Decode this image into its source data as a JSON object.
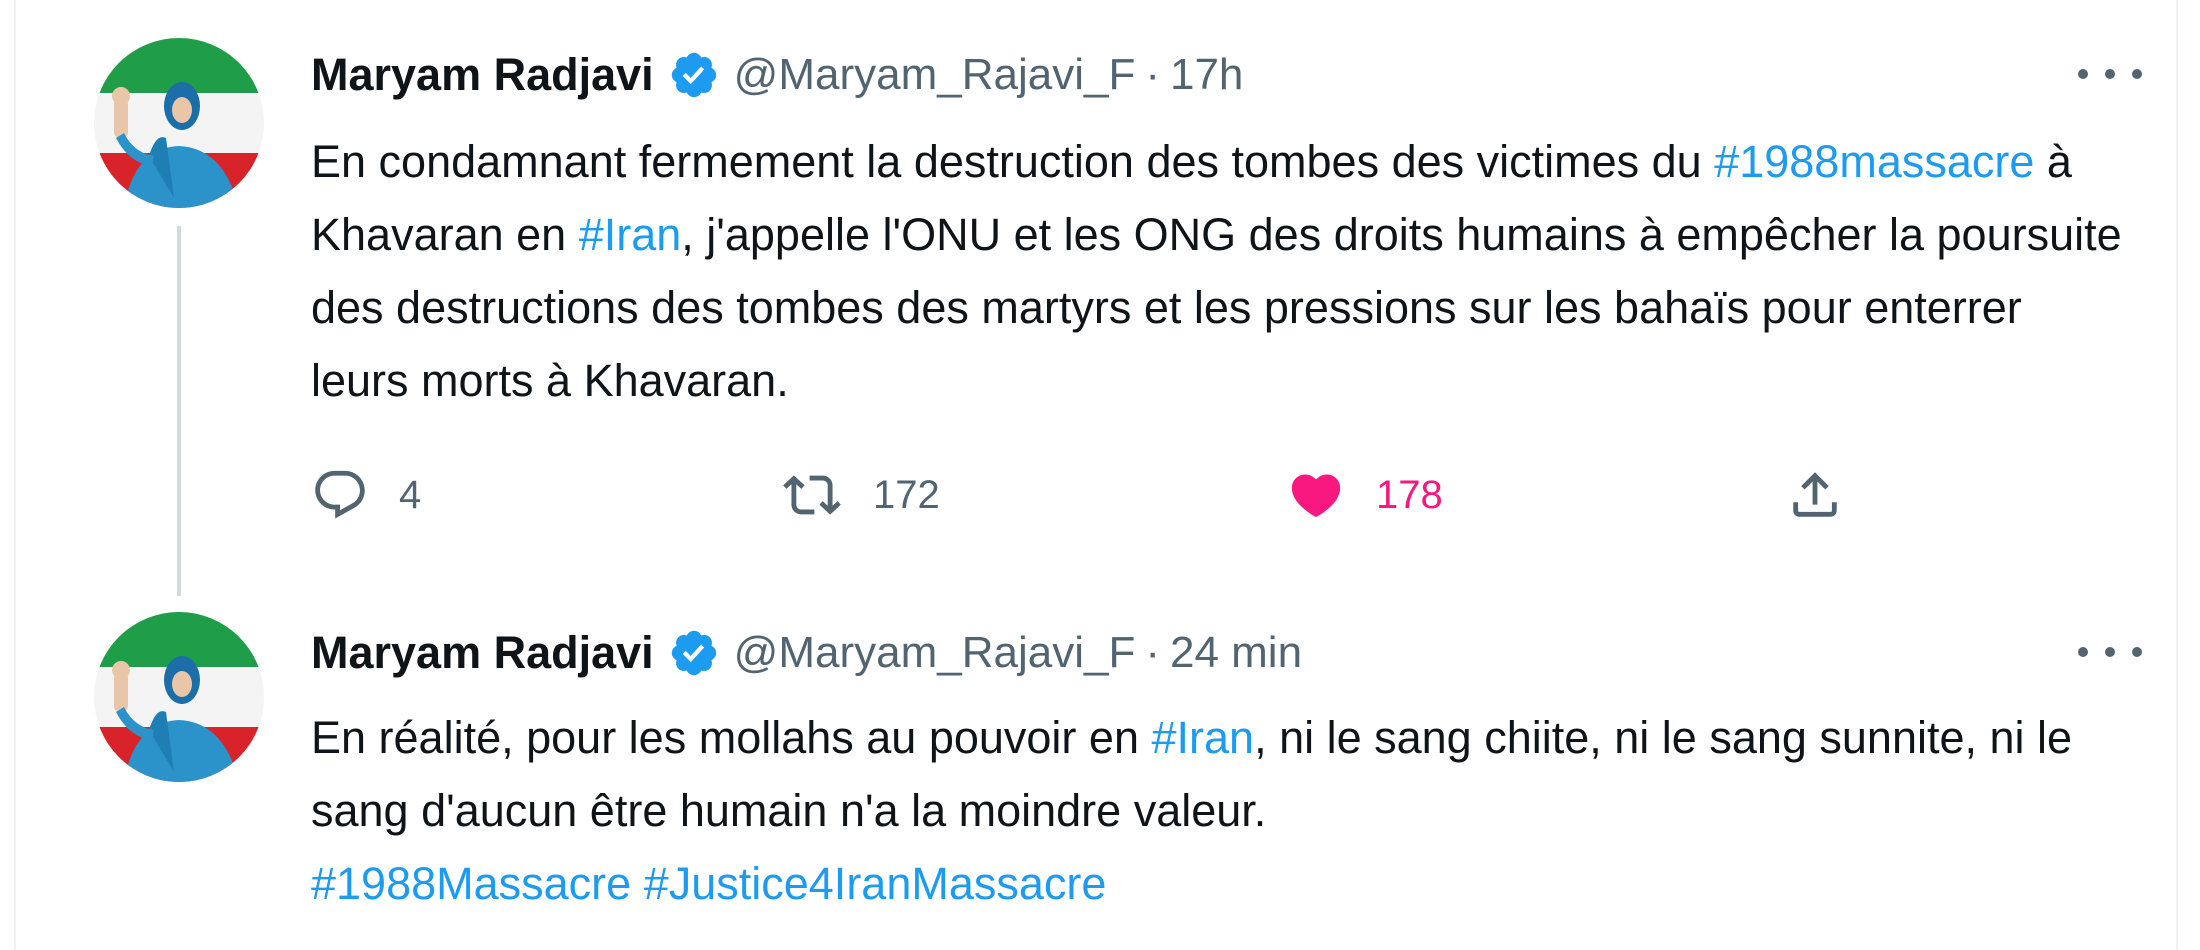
{
  "tweets": [
    {
      "author_name": "Maryam Radjavi",
      "handle": "@Maryam_Rajavi_F",
      "separator": "·",
      "time": "17h",
      "text_parts": [
        "En condamnant fermement la destruction des tombes des victimes du ",
        "#1988massacre",
        " à Khavaran en ",
        "#Iran",
        ", j'appelle l'ONU et les ONG des droits humains à empêcher la poursuite des destructions des tombes des martyrs et les pressions sur les bahaïs pour enterrer leurs morts à Khavaran."
      ],
      "actions": {
        "reply_count": "4",
        "retweet_count": "172",
        "like_count": "178",
        "liked": true
      }
    },
    {
      "author_name": "Maryam Radjavi",
      "handle": "@Maryam_Rajavi_F",
      "separator": "·",
      "time": "24 min",
      "text_parts": [
        "En réalité, pour les mollahs au pouvoir en ",
        "#Iran",
        ", ni le sang chiite, ni le sang sunnite, ni le sang d'aucun être humain n'a la moindre valeur.",
        "#1988Massacre",
        " ",
        "#Justice4IranMassacre"
      ]
    }
  ],
  "icons": {
    "verified": "verified-badge-icon",
    "more": "more-options-icon",
    "reply": "reply-bubble-icon",
    "retweet": "retweet-icon",
    "like": "heart-icon",
    "share": "share-upload-icon"
  },
  "colors": {
    "hashtag": "#1d9bf0",
    "like": "#f91880",
    "verified": "#1d9bf0",
    "muted": "#536471"
  }
}
